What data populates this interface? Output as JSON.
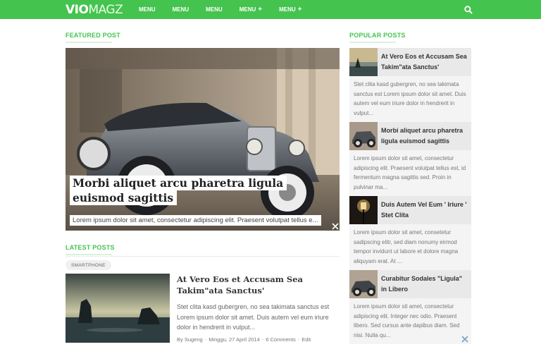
{
  "header": {
    "logo_bold": "VIO",
    "logo_light": "MAGZ",
    "nav": [
      {
        "label": "MENU",
        "has_sub": false
      },
      {
        "label": "MENU",
        "has_sub": false
      },
      {
        "label": "MENU",
        "has_sub": false
      },
      {
        "label": "MENU",
        "has_sub": true
      },
      {
        "label": "MENU",
        "has_sub": true
      }
    ],
    "plus": "+",
    "search_icon": "search-icon"
  },
  "featured": {
    "heading": "FEATURED POST",
    "title": "Morbi aliquet arcu pharetra ligula euismod sagittis",
    "excerpt": "Lorem ipsum dolor sit amet, consectetur adipiscing elit. Praesent volutpat tellus e...",
    "image": "vintage-car-photo"
  },
  "latest": {
    "heading": "LATEST POSTS",
    "tag": "SMARTPHONE",
    "post": {
      "title": "At Vero Eos et Accusam Sea Takim\"ata Sanctus'",
      "excerpt": "Stet clita kasd gubergren, no sea takimata sanctus est Lorem ipsum dolor sit amet. Duis autem vel eum iriure dolor in hendrerit in vulput...",
      "author": "By Sugeng",
      "date": "Minggu, 27 April 2014",
      "comments": "6 Comments",
      "edit": "Edit",
      "separator": "-",
      "image": "sea-rocks-photo"
    }
  },
  "popular": {
    "heading": "POPULAR POSTS",
    "items": [
      {
        "title": "At Vero Eos et Accusam Sea Takim\"ata Sanctus'",
        "excerpt": "Stet clita kasd gubergren, no sea takimata sanctus est Lorem ipsum dolor sit amet. Duis autem vel eum iriure dolor in hendrerit in vulput...",
        "image": "sea-rocks-photo"
      },
      {
        "title": "Morbi aliquet arcu pharetra ligula euismod sagittis",
        "excerpt": "Lorem ipsum dolor sit amet, consectetur adipiscing elit. Praesent volutpat tellus est, id fermentum magna sagittis sed. Proin in pulvinar ma...",
        "image": "vintage-car-photo"
      },
      {
        "title": "Duis Autem Vel Eum ' Iriure ' Stet Clita",
        "excerpt": "Lorem ipsum dolor sit amet, consetetur sadipscing elitr, sed diam nonumy eirmod tempor invidunt ut labore et dolore magna aliquyam erat. At ...",
        "image": "street-lamp-photo"
      },
      {
        "title": "Curabitur Sodales \"Ligula\" in Libero",
        "excerpt": "Lorem ipsum dolor sit amet, consectetur adipiscing elit. Integer nec odio. Praesent libero. Sed cursus ante dapibus diam. Sed nisi. Nulla qu...",
        "image": "vintage-car-photo"
      }
    ]
  },
  "colors": {
    "brand_green": "#45c34f",
    "sidebar_bg": "#f4f4f4",
    "sidebar_head_bg": "#e9e9e9"
  }
}
